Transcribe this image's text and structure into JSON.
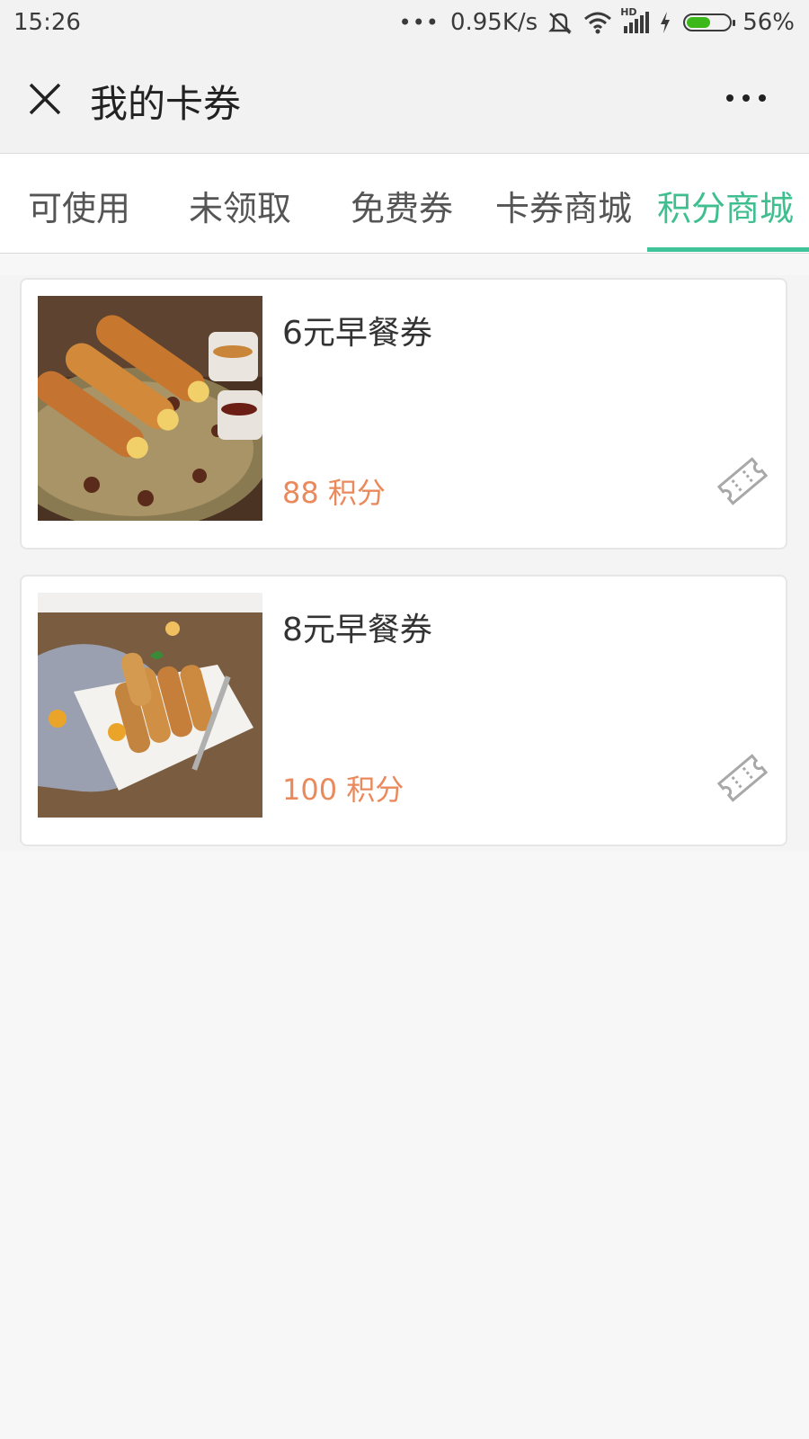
{
  "status_bar": {
    "time": "15:26",
    "dots": "•••",
    "speed": "0.95K/s",
    "network_label": "HD",
    "battery_percent": "56%",
    "battery_level": 0.56,
    "icons": [
      "mute-icon",
      "wifi-icon",
      "signal-icon",
      "charging-icon",
      "battery-icon"
    ]
  },
  "header": {
    "title": "我的卡券",
    "close_icon": "close-icon",
    "more_icon": "more-icon"
  },
  "tabs": [
    {
      "label": "可使用",
      "active": false
    },
    {
      "label": "未领取",
      "active": false
    },
    {
      "label": "免费券",
      "active": false
    },
    {
      "label": "卡券商城",
      "active": false
    },
    {
      "label": "积分商城",
      "active": true
    }
  ],
  "accent_color": "#3fc49a",
  "points_color": "#ea8a5c",
  "coupons": [
    {
      "title": "6元早餐券",
      "points": "88 积分",
      "image": "breakfast-rolls-with-sauce-photo"
    },
    {
      "title": "8元早餐券",
      "points": "100 积分",
      "image": "spring-rolls-on-plate-photo"
    }
  ]
}
